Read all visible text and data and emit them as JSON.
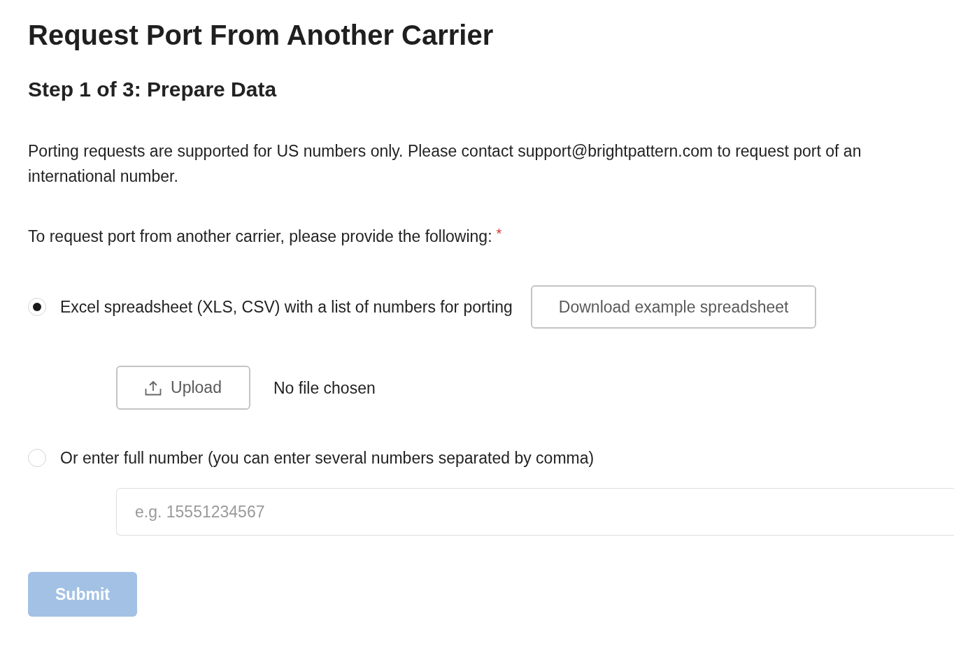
{
  "page": {
    "title": "Request Port From Another Carrier",
    "step_title": "Step 1 of 3: Prepare Data"
  },
  "notice": "Porting requests are supported for US numbers only. Please contact support@brightpattern.com to request port of an international number.",
  "prompt": {
    "text": "To request port from another carrier, please provide the following:",
    "required_mark": "*"
  },
  "options": [
    {
      "kind": "spreadsheet",
      "label": "Excel spreadsheet (XLS, CSV) with a list of numbers for porting",
      "selected": true,
      "download_button": "Download example spreadsheet",
      "upload_button": "Upload",
      "file_status": "No file chosen"
    },
    {
      "kind": "number",
      "label": "Or enter full number (you can enter several numbers separated by comma)",
      "selected": false,
      "input": {
        "placeholder": "e.g. 15551234567"
      }
    }
  ],
  "submit": {
    "label": "Submit",
    "disabled": true
  }
}
